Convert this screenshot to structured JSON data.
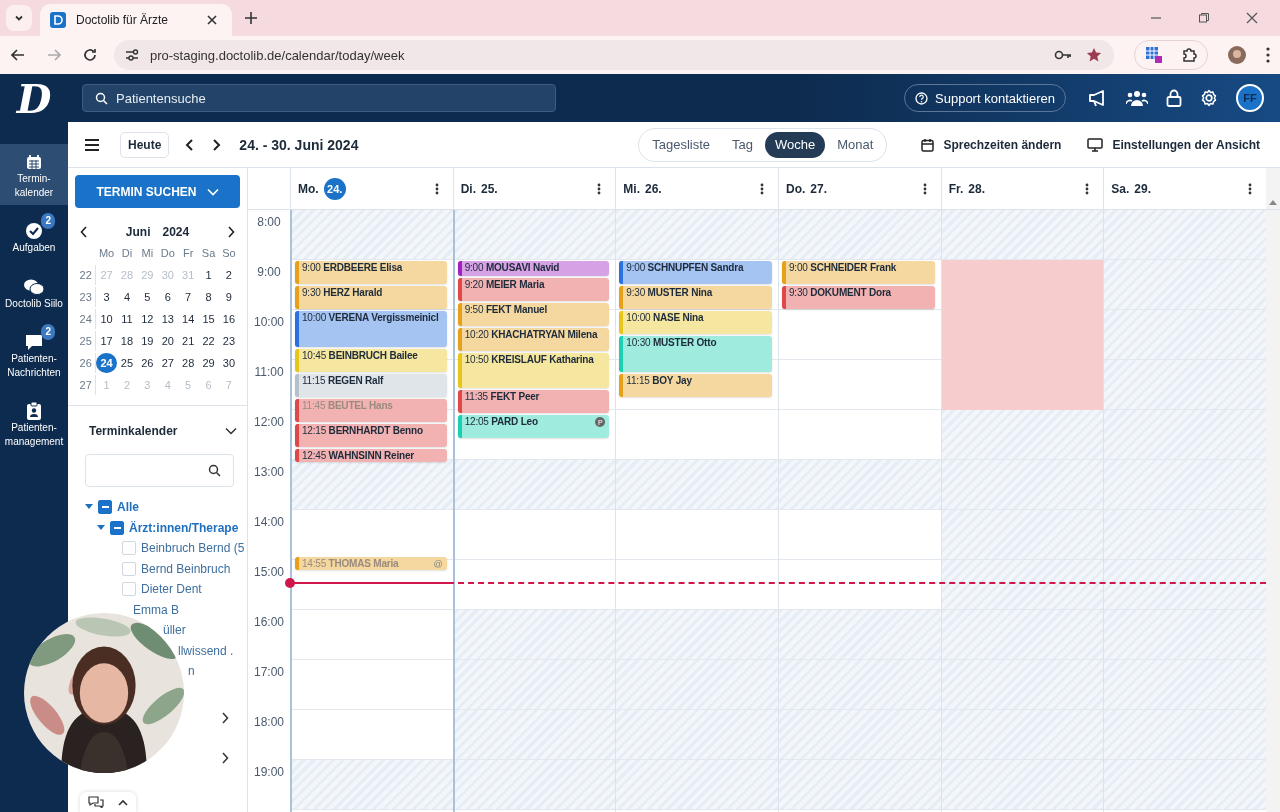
{
  "browser": {
    "tab_title": "Doctolib für Ärzte",
    "url": "pro-staging.doctolib.de/calendar/today/week"
  },
  "header": {
    "logo": "D",
    "search": {
      "placeholder": "Patientensuche"
    },
    "support": "Support kontaktieren",
    "avatar": "FF"
  },
  "nav": [
    {
      "label": "Termin-\nkalender",
      "selected": true
    },
    {
      "label": "Aufgaben",
      "badge": "2",
      "selected": false
    },
    {
      "label": "Doctolib Siilo",
      "selected": false
    },
    {
      "label": "Patienten-\nNachrichten",
      "badge": "2",
      "selected": false
    },
    {
      "label": "Patienten-\nmanagement",
      "selected": false
    }
  ],
  "toolbar": {
    "today": "Heute",
    "range": "24. - 30. Juni 2024",
    "views": [
      {
        "label": "Tagesliste",
        "selected": false
      },
      {
        "label": "Tag",
        "selected": false
      },
      {
        "label": "Woche",
        "selected": true
      },
      {
        "label": "Monat",
        "selected": false
      }
    ],
    "hours_button": "Sprechzeiten ändern",
    "view_settings": "Einstellungen der Ansicht"
  },
  "sidebar": {
    "search_button": "TERMIN SUCHEN",
    "mini_calendar": {
      "month": "Juni",
      "year": "2024",
      "weekdays": [
        "Mo",
        "Di",
        "Mi",
        "Do",
        "Fr",
        "Sa",
        "So"
      ],
      "weeks": [
        {
          "week": "22",
          "days": [
            {
              "d": "27",
              "muted": true,
              "selected": false
            },
            {
              "d": "28",
              "muted": true,
              "selected": false
            },
            {
              "d": "29",
              "muted": true,
              "selected": false
            },
            {
              "d": "30",
              "muted": true,
              "selected": false
            },
            {
              "d": "31",
              "muted": true,
              "selected": false
            },
            {
              "d": "1",
              "muted": false,
              "selected": false
            },
            {
              "d": "2",
              "muted": false,
              "selected": false
            }
          ]
        },
        {
          "week": "23",
          "days": [
            {
              "d": "3",
              "muted": false,
              "selected": false
            },
            {
              "d": "4",
              "muted": false,
              "selected": false
            },
            {
              "d": "5",
              "muted": false,
              "selected": false
            },
            {
              "d": "6",
              "muted": false,
              "selected": false
            },
            {
              "d": "7",
              "muted": false,
              "selected": false
            },
            {
              "d": "8",
              "muted": false,
              "selected": false
            },
            {
              "d": "9",
              "muted": false,
              "selected": false
            }
          ]
        },
        {
          "week": "24",
          "days": [
            {
              "d": "10",
              "muted": false,
              "selected": false
            },
            {
              "d": "11",
              "muted": false,
              "selected": false
            },
            {
              "d": "12",
              "muted": false,
              "selected": false
            },
            {
              "d": "13",
              "muted": false,
              "selected": false
            },
            {
              "d": "14",
              "muted": false,
              "selected": false
            },
            {
              "d": "15",
              "muted": false,
              "selected": false
            },
            {
              "d": "16",
              "muted": false,
              "selected": false
            }
          ]
        },
        {
          "week": "25",
          "days": [
            {
              "d": "17",
              "muted": false,
              "selected": false
            },
            {
              "d": "18",
              "muted": false,
              "selected": false
            },
            {
              "d": "19",
              "muted": false,
              "selected": false
            },
            {
              "d": "20",
              "muted": false,
              "selected": false
            },
            {
              "d": "21",
              "muted": false,
              "selected": false
            },
            {
              "d": "22",
              "muted": false,
              "selected": false
            },
            {
              "d": "23",
              "muted": false,
              "selected": false
            }
          ]
        },
        {
          "week": "26",
          "days": [
            {
              "d": "24",
              "muted": false,
              "selected": true
            },
            {
              "d": "25",
              "muted": false,
              "selected": false
            },
            {
              "d": "26",
              "muted": false,
              "selected": false
            },
            {
              "d": "27",
              "muted": false,
              "selected": false
            },
            {
              "d": "28",
              "muted": false,
              "selected": false
            },
            {
              "d": "29",
              "muted": false,
              "selected": false
            },
            {
              "d": "30",
              "muted": false,
              "selected": false
            }
          ]
        },
        {
          "week": "27",
          "days": [
            {
              "d": "1",
              "muted": true,
              "selected": false
            },
            {
              "d": "2",
              "muted": true,
              "selected": false
            },
            {
              "d": "3",
              "muted": true,
              "selected": false
            },
            {
              "d": "4",
              "muted": true,
              "selected": false
            },
            {
              "d": "5",
              "muted": true,
              "selected": false
            },
            {
              "d": "6",
              "muted": true,
              "selected": false
            },
            {
              "d": "7",
              "muted": true,
              "selected": false
            }
          ]
        }
      ]
    },
    "calendars_title": "Terminkalender",
    "tree": [
      {
        "label": "Alle",
        "partial": true,
        "expanded": true,
        "children": [
          {
            "label": "Ärzt:innen/Therape",
            "partial": true,
            "expanded": true,
            "children": [
              {
                "label": "Beinbruch Bernd (5",
                "checked": false
              },
              {
                "label": "Bernd Beinbruch",
                "checked": false
              },
              {
                "label": "Dieter Dent",
                "checked": false
              },
              {
                "label": "Emma B",
                "kind": "fragment"
              },
              {
                "label": "üller",
                "kind": "fragment"
              },
              {
                "label": "llwissend .",
                "kind": "fragment"
              },
              {
                "label": "n",
                "kind": "fragment"
              }
            ]
          }
        ]
      }
    ]
  },
  "week": {
    "hours": [
      "8:00",
      "9:00",
      "10:00",
      "11:00",
      "12:00",
      "13:00",
      "14:00",
      "15:00",
      "16:00",
      "17:00",
      "18:00",
      "19:00"
    ],
    "days": [
      {
        "weekday": "Mo.",
        "date": "24.",
        "today": true,
        "open": [
          false,
          true,
          true,
          true,
          true,
          false,
          true,
          true,
          true,
          true,
          true,
          false
        ],
        "events": [
          {
            "time": "9:00",
            "name": "ERDBEERE Elisa",
            "color": "#e5a11a",
            "faded": false
          },
          {
            "time": "9:30",
            "name": "HERZ Harald",
            "color": "#e5a11a",
            "faded": false
          },
          {
            "time": "10:00",
            "name": "VERENA Vergissmeinicl",
            "color": "#2a72e0",
            "faded": false
          },
          {
            "time": "10:45",
            "name": "BEINBRUCH Bailee",
            "color": "#e8c51a",
            "faded": false
          },
          {
            "time": "11:15",
            "name": "REGEN Ralf",
            "color": "#b5c0cc",
            "faded": false
          },
          {
            "time": "11:45",
            "name": "BEUTEL Hans",
            "color": "#e04848",
            "faded": true
          },
          {
            "time": "12:15",
            "name": "BERNHARDT Benno",
            "color": "#e04848",
            "faded": false
          },
          {
            "time": "12:45",
            "name": "WAHNSINN Reiner",
            "color": "#e04848",
            "faded": false
          },
          {
            "time": "14:55",
            "name": "THOMAS Maria",
            "color": "#e5a11a",
            "faded": true,
            "badge": {
              "kind": "plain",
              "text": "@"
            }
          }
        ]
      },
      {
        "weekday": "Di.",
        "date": "25.",
        "today": false,
        "open": [
          false,
          true,
          true,
          true,
          true,
          false,
          true,
          true,
          false,
          false,
          false,
          false
        ],
        "events": [
          {
            "time": "9:00",
            "name": "MOUSAVI Navid",
            "color": "#a020c0",
            "faded": false
          },
          {
            "time": "9:20",
            "name": "MEIER Maria",
            "color": "#e04848",
            "faded": false
          },
          {
            "time": "9:50",
            "name": "FEKT Manuel",
            "color": "#e5a11a",
            "faded": false
          },
          {
            "time": "10:20",
            "name": "KHACHATRYAN Milena",
            "color": "#e5a11a",
            "faded": false
          },
          {
            "time": "10:50",
            "name": "KREISLAUF Katharina",
            "color": "#e8c51a",
            "faded": false
          },
          {
            "time": "11:35",
            "name": "FEKT Peer",
            "color": "#e04848",
            "faded": false
          },
          {
            "time": "12:05",
            "name": "PARD Leo",
            "color": "#1ad0b0",
            "faded": false,
            "badge": {
              "kind": "circle",
              "text": "P"
            }
          }
        ]
      },
      {
        "weekday": "Mi.",
        "date": "26.",
        "today": false,
        "open": [
          false,
          true,
          true,
          true,
          true,
          false,
          true,
          true,
          false,
          false,
          false,
          false
        ],
        "events": [
          {
            "time": "9:00",
            "name": "SCHNUPFEN Sandra",
            "color": "#2a72e0",
            "faded": false
          },
          {
            "time": "9:30",
            "name": "MUSTER Nina",
            "color": "#e5a11a",
            "faded": false
          },
          {
            "time": "10:00",
            "name": "NASE Nina",
            "color": "#e8c51a",
            "faded": false
          },
          {
            "time": "10:30",
            "name": "MUSTER Otto",
            "color": "#1ad0b0",
            "faded": false
          },
          {
            "time": "11:15",
            "name": "BOY Jay",
            "color": "#e5a11a",
            "faded": false
          }
        ]
      },
      {
        "weekday": "Do.",
        "date": "27.",
        "today": false,
        "open": [
          false,
          true,
          true,
          true,
          true,
          false,
          true,
          true,
          false,
          false,
          false,
          false
        ],
        "events": [
          {
            "time": "9:00",
            "name": "SCHNEIDER Frank",
            "color": "#e5a11a",
            "faded": false
          },
          {
            "time": "9:30",
            "name": "DOKUMENT Dora",
            "color": "#e04848",
            "faded": false
          }
        ]
      },
      {
        "weekday": "Fr.",
        "date": "28.",
        "today": false,
        "open": [
          false,
          false,
          false,
          false,
          false,
          false,
          false,
          false,
          false,
          false,
          false,
          false
        ],
        "blocked": [
          false,
          true,
          true,
          true,
          false,
          false,
          false,
          false,
          false,
          false,
          false,
          false
        ]
      },
      {
        "weekday": "Sa.",
        "date": "29.",
        "today": false,
        "open": [
          false,
          false,
          false,
          false,
          false,
          false,
          false,
          false,
          false,
          false,
          false,
          false
        ]
      }
    ]
  }
}
